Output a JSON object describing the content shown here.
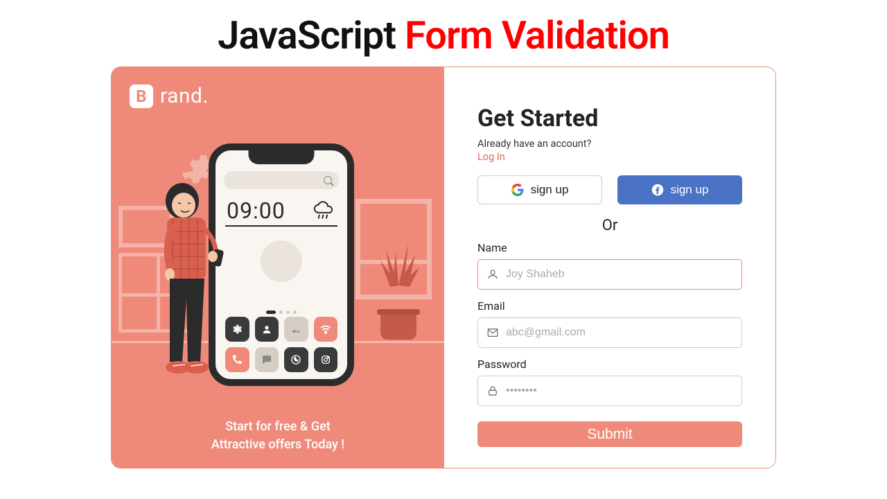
{
  "title": {
    "part1": "JavaScript",
    "part2": "Form Validation"
  },
  "brand": {
    "icon_letter": "B",
    "name": "rand."
  },
  "illustration": {
    "time": "09:00"
  },
  "tagline": {
    "line1": "Start for free & Get",
    "line2": "Attractive offers Today !"
  },
  "form": {
    "headline": "Get Started",
    "already": "Already have an account?",
    "login": "Log In",
    "social": {
      "google": "sign up",
      "facebook": "sign up"
    },
    "or": "Or",
    "name": {
      "label": "Name",
      "placeholder": "Joy Shaheb",
      "value": ""
    },
    "email": {
      "label": "Email",
      "placeholder": "abc@gmail.com",
      "value": ""
    },
    "password": {
      "label": "Password",
      "placeholder": "••••••••",
      "value": ""
    },
    "submit": "Submit"
  },
  "colors": {
    "accent": "#ef8a7a",
    "fb": "#4a72c5",
    "title_accent": "#ff0000"
  }
}
